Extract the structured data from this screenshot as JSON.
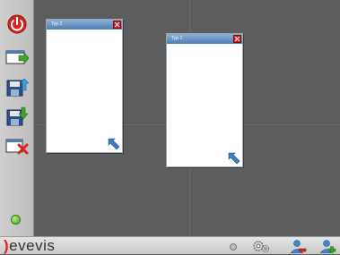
{
  "toolbar": {
    "buttons": [
      {
        "name": "power-icon"
      },
      {
        "name": "add-panel-icon"
      },
      {
        "name": "load-layout-icon"
      },
      {
        "name": "save-layout-icon"
      },
      {
        "name": "delete-panel-icon"
      }
    ],
    "status": "online"
  },
  "panels": [
    {
      "title": "Typ 2"
    },
    {
      "title": "Typ 1"
    }
  ],
  "bottombar": {
    "logo_bracket": ")",
    "logo_text": "evevis",
    "icons": [
      "indicator-icon",
      "settings-icon",
      "user-remove-icon",
      "user-add-icon"
    ]
  },
  "colors": {
    "accent_red": "#e0201b",
    "panel_header": "#4e7db6",
    "status_green": "#4aa01a"
  }
}
